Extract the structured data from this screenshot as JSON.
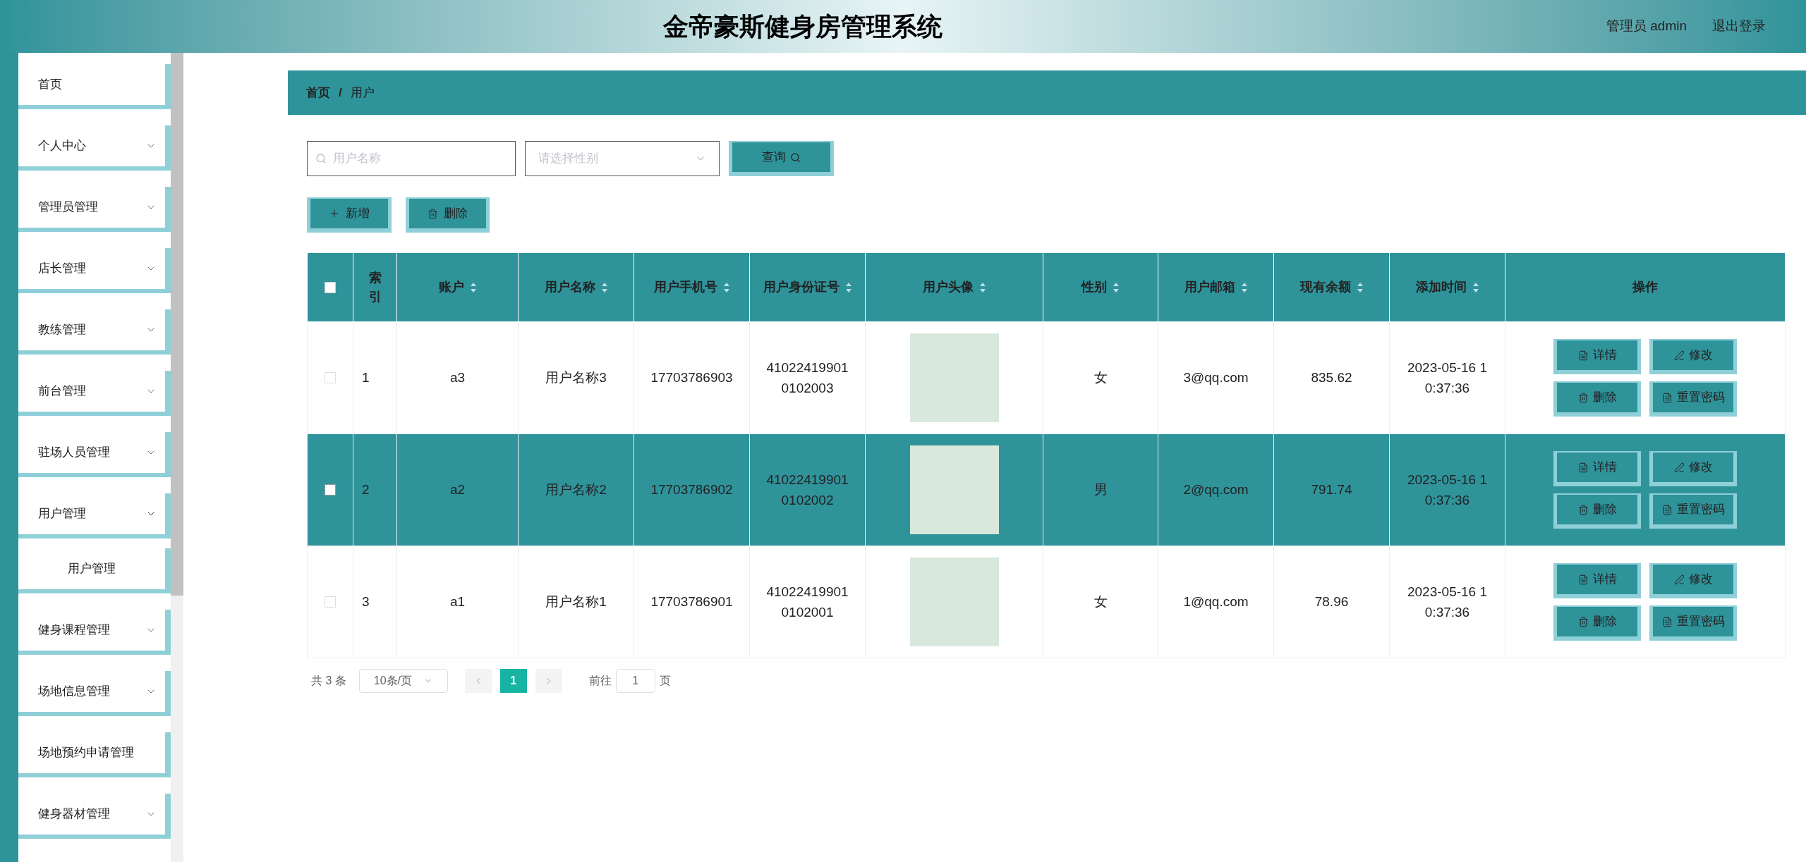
{
  "header": {
    "title": "金帝豪斯健身房管理系统",
    "user": "管理员 admin",
    "logout": "退出登录"
  },
  "sidebar": {
    "items": [
      {
        "label": "首页",
        "kind": "link"
      },
      {
        "label": "个人中心",
        "kind": "group",
        "expanded": false
      },
      {
        "label": "管理员管理",
        "kind": "group",
        "expanded": false
      },
      {
        "label": "店长管理",
        "kind": "group",
        "expanded": false
      },
      {
        "label": "教练管理",
        "kind": "group",
        "expanded": false
      },
      {
        "label": "前台管理",
        "kind": "group",
        "expanded": false
      },
      {
        "label": "驻场人员管理",
        "kind": "group",
        "expanded": false
      },
      {
        "label": "用户管理",
        "kind": "group",
        "expanded": true,
        "children": [
          {
            "label": "用户管理"
          }
        ]
      },
      {
        "label": "健身课程管理",
        "kind": "group",
        "expanded": false
      },
      {
        "label": "场地信息管理",
        "kind": "group",
        "expanded": false
      },
      {
        "label": "场地预约申请管理",
        "kind": "link"
      },
      {
        "label": "健身器材管理",
        "kind": "group",
        "expanded": false
      }
    ]
  },
  "breadcrumb": {
    "items": [
      "首页",
      "用户"
    ],
    "separator": "/"
  },
  "search": {
    "name_placeholder": "用户名称",
    "gender_placeholder": "请选择性别",
    "query_button": "查询"
  },
  "actions": [
    "新增",
    "删除"
  ],
  "table": {
    "select_all_checked": false,
    "columns": [
      {
        "label": "索引",
        "sortable": false
      },
      {
        "label": "账户",
        "sortable": true
      },
      {
        "label": "用户名称",
        "sortable": true
      },
      {
        "label": "用户手机号",
        "sortable": true
      },
      {
        "label": "用户身份证号",
        "sortable": true
      },
      {
        "label": "用户头像",
        "sortable": true
      },
      {
        "label": "性别",
        "sortable": true
      },
      {
        "label": "用户邮箱",
        "sortable": true
      },
      {
        "label": "现有余额",
        "sortable": true
      },
      {
        "label": "添加时间",
        "sortable": true
      },
      {
        "label": "操作",
        "sortable": false
      }
    ],
    "rows": [
      {
        "selected": false,
        "checked": false,
        "cells": [
          "1",
          "a3",
          "用户名称3",
          "17703786903",
          "41022419901\n0102003",
          null,
          "女",
          "3@qq.com",
          "835.62",
          "2023-05-16 1\n0:37:36"
        ],
        "actions": [
          {
            "label": "详情",
            "kind": "detail"
          },
          {
            "label": "修改",
            "kind": "edit"
          },
          {
            "label": "删除",
            "kind": "delete"
          },
          {
            "label": "重置密码",
            "kind": "reset"
          }
        ]
      },
      {
        "selected": true,
        "checked": false,
        "cells": [
          "2",
          "a2",
          "用户名称2",
          "17703786902",
          "41022419901\n0102002",
          null,
          "男",
          "2@qq.com",
          "791.74",
          "2023-05-16 1\n0:37:36"
        ],
        "actions": [
          {
            "label": "详情",
            "kind": "detail"
          },
          {
            "label": "修改",
            "kind": "edit"
          },
          {
            "label": "删除",
            "kind": "delete"
          },
          {
            "label": "重置密码",
            "kind": "reset"
          }
        ]
      },
      {
        "selected": false,
        "checked": false,
        "cells": [
          "3",
          "a1",
          "用户名称1",
          "17703786901",
          "41022419901\n0102001",
          null,
          "女",
          "1@qq.com",
          "78.96",
          "2023-05-16 1\n0:37:36"
        ],
        "actions": [
          {
            "label": "详情",
            "kind": "detail"
          },
          {
            "label": "修改",
            "kind": "edit"
          },
          {
            "label": "删除",
            "kind": "delete"
          },
          {
            "label": "重置密码",
            "kind": "reset"
          }
        ]
      }
    ]
  },
  "pagination": {
    "total": "共 3 条",
    "page_size": "10条/页",
    "pages": [
      {
        "label": "1",
        "selected": true
      }
    ],
    "goto_label": "前往",
    "goto_value": "1",
    "goto_suffix": "页"
  }
}
